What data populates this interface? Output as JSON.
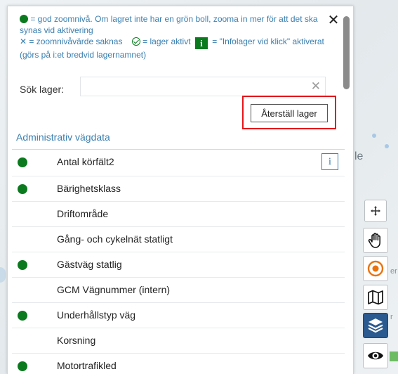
{
  "help": {
    "line1": "= god zoomnivå. Om lagret inte har en grön boll, zooma in mer för att det ska synas vid aktivering",
    "x_symbol": "✕",
    "line2a": "= zoomnivåvärde saknas",
    "line2b": "= lager aktivt",
    "info_glyph": "i",
    "line2c": "= \"Infolager vid klick\" aktiverat (görs på i:et bredvid lagernamnet)"
  },
  "close_symbol": "✕",
  "search": {
    "label": "Sök lager:",
    "value": "",
    "placeholder": "",
    "clear_symbol": "✕"
  },
  "reset_button": "Återställ lager",
  "section": {
    "title": "Administrativ vägdata"
  },
  "layers": [
    {
      "label": "Antal körfält2",
      "good_zoom": true,
      "info": "i"
    },
    {
      "label": "Bärighetsklass",
      "good_zoom": true
    },
    {
      "label": "Driftområde",
      "good_zoom": false
    },
    {
      "label": "Gång- och cykelnät statligt",
      "good_zoom": false
    },
    {
      "label": "Gästväg statlig",
      "good_zoom": true
    },
    {
      "label": "GCM Vägnummer (intern)",
      "good_zoom": false
    },
    {
      "label": "Underhållstyp väg",
      "good_zoom": true
    },
    {
      "label": "Korsning",
      "good_zoom": false
    },
    {
      "label": "Motortrafikled",
      "good_zoom": true
    }
  ],
  "map_labels": {
    "le": "le",
    "er": "er",
    "r": "r"
  },
  "colors": {
    "green": "#0b7a1f",
    "link_blue": "#3a7fb0",
    "highlight_red": "#e3151a",
    "active_tool": "#2a5a8f",
    "target_orange": "#e8720c"
  },
  "toolbar": [
    {
      "name": "move-icon",
      "active": false
    },
    {
      "name": "hand-pan-icon",
      "active": false
    },
    {
      "name": "target-icon",
      "active": false
    },
    {
      "name": "map-icon",
      "active": false
    },
    {
      "name": "layers-icon",
      "active": true
    },
    {
      "name": "eye-icon",
      "active": false
    }
  ]
}
